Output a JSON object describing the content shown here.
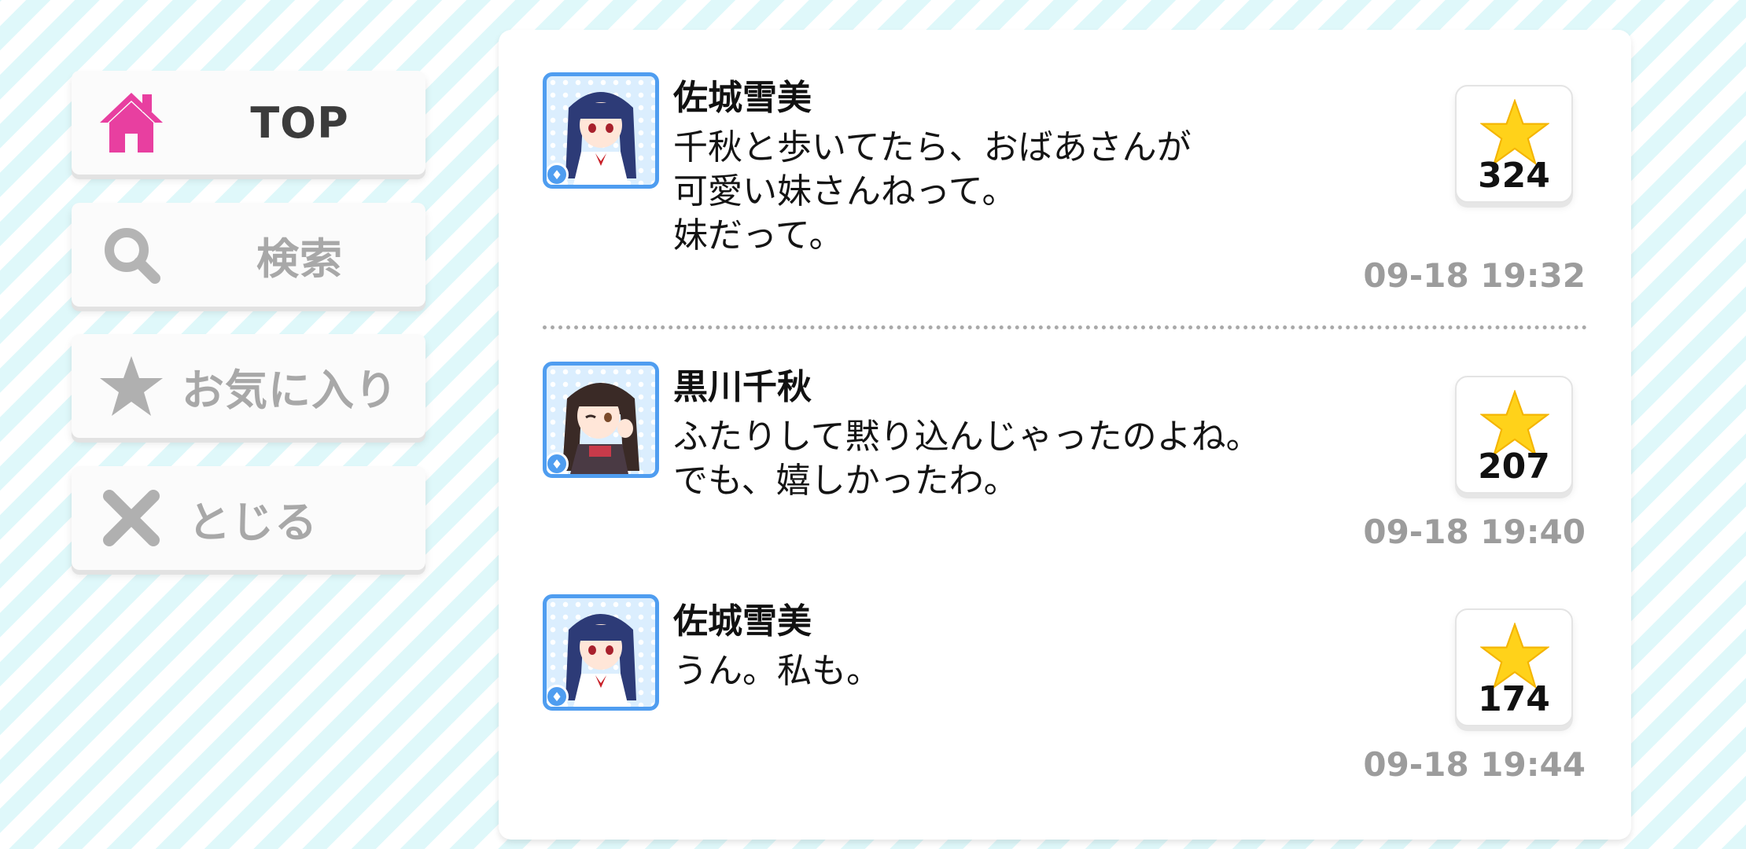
{
  "menu": {
    "top": {
      "label": "TOP",
      "icon": "home-icon",
      "color": "#e83fa0"
    },
    "search": {
      "label": "検索",
      "icon": "search-icon"
    },
    "favorites": {
      "label": "お気に入り",
      "icon": "star-icon"
    },
    "close": {
      "label": "とじる",
      "icon": "close-icon"
    }
  },
  "posts": [
    {
      "author": "佐城雪美",
      "lines": [
        "千秋と歩いてたら、おばあさんが",
        "可愛い妹さんねって。",
        "妹だって。"
      ],
      "likes": "324",
      "time": "09-18 19:32"
    },
    {
      "author": "黒川千秋",
      "lines": [
        "ふたりして黙り込んじゃったのよね。",
        "でも、嬉しかったわ。"
      ],
      "likes": "207",
      "time": "09-18 19:40"
    },
    {
      "author": "佐城雪美",
      "lines": [
        "うん。私も。"
      ],
      "likes": "174",
      "time": "09-18 19:44"
    }
  ],
  "colors": {
    "accent_pink": "#e83fa0",
    "star_yellow": "#ffd21a",
    "avatar_border": "#4f9df0",
    "timestamp": "#9c9c9c",
    "stripe": "#dff8fa"
  }
}
